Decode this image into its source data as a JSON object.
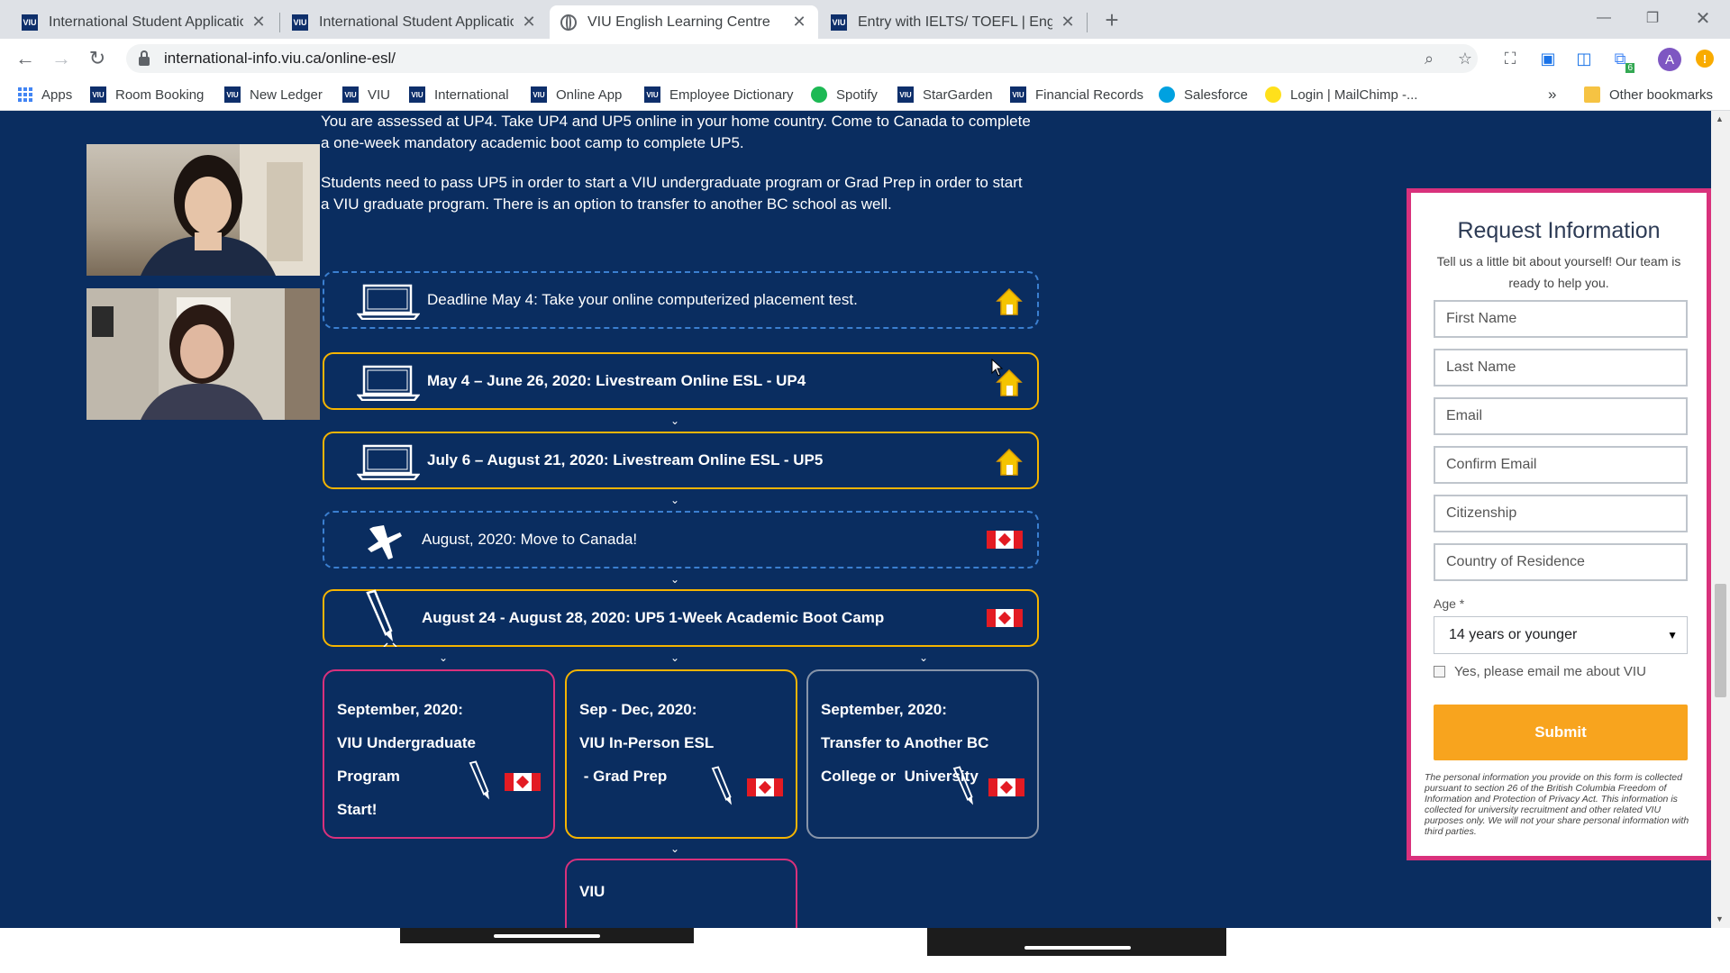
{
  "browser": {
    "tabs": [
      {
        "title": "International Student Application",
        "favicon": "viu-logo",
        "active": false
      },
      {
        "title": "International Student Application",
        "favicon": "viu-logo",
        "active": false
      },
      {
        "title": "VIU English Learning Centre",
        "favicon": "globe-icon",
        "active": true
      },
      {
        "title": "Entry with IELTS/ TOEFL | English",
        "favicon": "viu-logo",
        "active": false
      }
    ],
    "new_tab": "+",
    "url": "international-info.viu.ca/online-esl/",
    "bookmarks": [
      {
        "label": "Apps",
        "icon": "apps-grid-icon"
      },
      {
        "label": "Room Booking",
        "icon": "viu-logo"
      },
      {
        "label": "New Ledger",
        "icon": "viu-logo"
      },
      {
        "label": "VIU",
        "icon": "viu-logo"
      },
      {
        "label": "International",
        "icon": "viu-logo"
      },
      {
        "label": "Online App",
        "icon": "viu-logo"
      },
      {
        "label": "Employee Dictionary",
        "icon": "viu-logo"
      },
      {
        "label": "Spotify",
        "icon": "spotify-icon"
      },
      {
        "label": "StarGarden",
        "icon": "viu-logo"
      },
      {
        "label": "Financial Records",
        "icon": "viu-logo"
      },
      {
        "label": "Salesforce",
        "icon": "salesforce-icon"
      },
      {
        "label": "Login | MailChimp -...",
        "icon": "mailchimp-icon"
      }
    ],
    "bookmarks_overflow": "»",
    "other_bookmarks": "Other bookmarks",
    "profile_initial": "A",
    "extension_badge": "6"
  },
  "page": {
    "intro_1": "You are assessed at UP4. Take UP4 and UP5 online in your home country. Come to Canada to complete a one-week mandatory academic boot camp to complete UP5.",
    "intro_2": "Students need to pass UP5 in order to start a VIU undergraduate program or Grad Prep in order to start a VIU graduate program. There is an option to transfer to another BC school as well.",
    "timeline": [
      {
        "text": "Deadline May 4:  Take your online computerized placement test.",
        "lead_icon": "laptop-icon",
        "trail_icon": "house-icon",
        "style": "dashed"
      },
      {
        "text": "May 4 – June 26, 2020: Livestream Online ESL - UP4",
        "lead_icon": "laptop-icon",
        "trail_icon": "house-icon",
        "style": "solid"
      },
      {
        "text": "July 6 – August 21, 2020: Livestream Online ESL - UP5",
        "lead_icon": "laptop-icon",
        "trail_icon": "house-icon",
        "style": "solid"
      },
      {
        "text": "August, 2020: Move to Canada!",
        "lead_icon": "airplane-icon",
        "trail_icon": "canada-flag-icon",
        "style": "dashed"
      },
      {
        "text": "August 24  - August 28, 2020:  UP5 1-Week Academic Boot Camp",
        "lead_icon": "pen-icon",
        "trail_icon": "canada-flag-icon",
        "style": "solid"
      }
    ],
    "cards": [
      {
        "lines": [
          "September, 2020:",
          "VIU Undergraduate",
          "Program",
          "Start!"
        ]
      },
      {
        "lines": [
          "Sep - Dec, 2020:",
          "VIU In-Person ESL",
          " - Grad Prep"
        ]
      },
      {
        "lines": [
          "September, 2020:",
          "Transfer to Another BC",
          "College or  University"
        ]
      }
    ],
    "bottom_card": "VIU"
  },
  "form": {
    "title": "Request Information",
    "subtitle": "Tell us a little bit about yourself! Our team is ready to help you.",
    "placeholders": {
      "first_name": "First Name",
      "last_name": "Last Name",
      "email": "Email",
      "confirm_email": "Confirm Email",
      "citizenship": "Citizenship",
      "country": "Country of Residence"
    },
    "age_label": "Age *",
    "age_value": "14 years or younger",
    "checkbox_label": "Yes, please email me about VIU",
    "submit": "Submit",
    "disclaimer": "The personal information you provide on this form is collected pursuant to section 26 of the British Columbia Freedom of Information and Protection of Privacy Act. This information is collected for university recruitment and other related VIU purposes only. We will not your share personal information with third parties."
  },
  "colors": {
    "page_bg": "#0a2d60",
    "accent_gold": "#f5b400",
    "accent_pink": "#d9317c",
    "dashed_blue": "#3b7fd0",
    "submit_orange": "#f8a41e"
  }
}
